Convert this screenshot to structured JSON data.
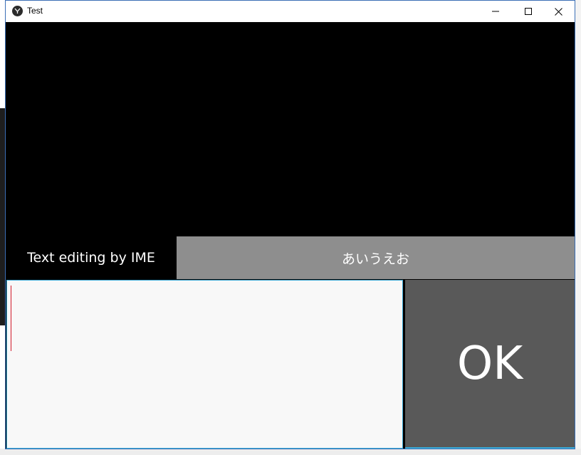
{
  "window": {
    "title": "Test"
  },
  "titlebar": {
    "minimize_icon": "minimize-icon",
    "maximize_icon": "maximize-icon",
    "close_icon": "close-icon"
  },
  "main": {
    "ime_label": "Text editing by IME",
    "ime_text": "あいうえお",
    "text_input_value": "",
    "ok_label": "OK"
  },
  "colors": {
    "ime_display_bg": "#8e8e8e",
    "ok_button_bg": "#595959",
    "input_bg": "#f8f8f8",
    "caret": "#d11a2a",
    "focus_border": "#39a9d6"
  }
}
